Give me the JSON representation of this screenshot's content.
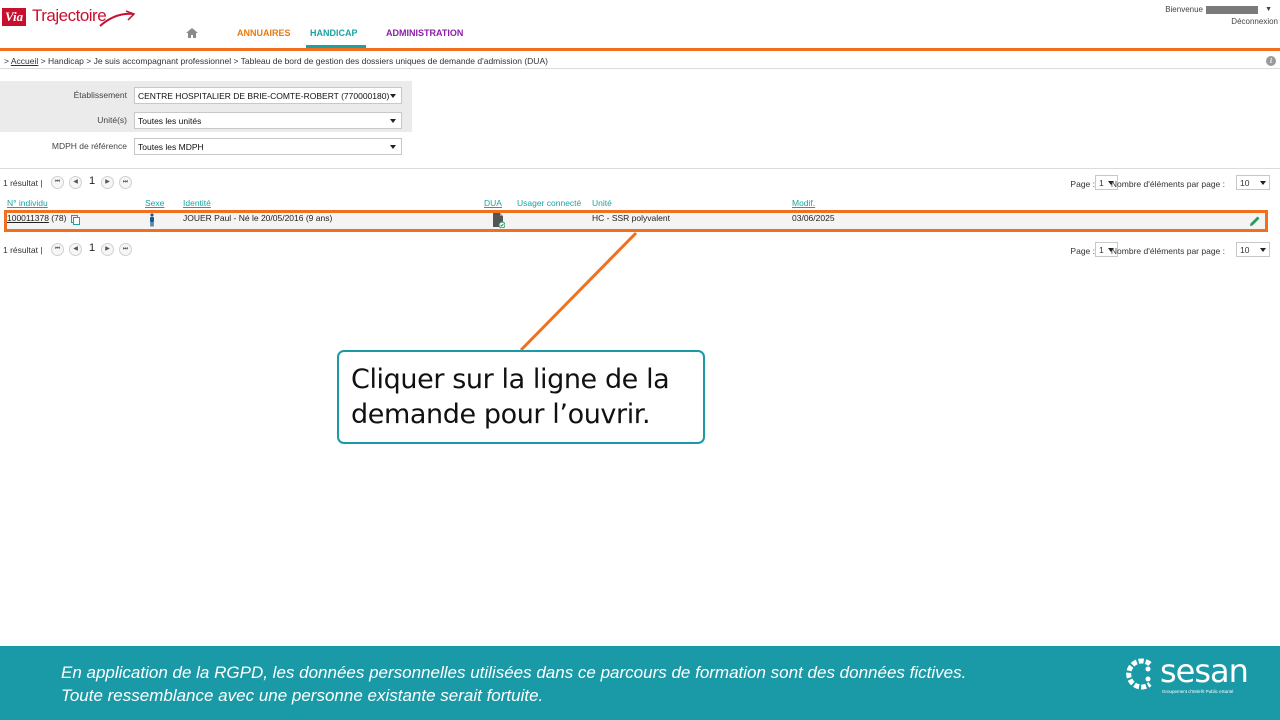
{
  "app": {
    "logo_via": "Via",
    "logo_traj": "Trajectoire"
  },
  "nav": {
    "annuaires": "ANNUAIRES",
    "handicap": "HANDICAP",
    "administration": "ADMINISTRATION"
  },
  "user": {
    "welcome": "Bienvenue",
    "logout": "Déconnexion"
  },
  "breadcrumb": {
    "prefix": ">",
    "home": "Accueil",
    "rest": "> Handicap > Je suis accompagnant professionnel > Tableau de bord de gestion des dossiers uniques de demande d'admission (DUA)"
  },
  "filters": [
    {
      "label": "Établissement",
      "value": "CENTRE HOSPITALIER DE BRIE-COMTE-ROBERT (770000180)"
    },
    {
      "label": "Unité(s)",
      "value": "Toutes les unités"
    },
    {
      "label": "MDPH de référence",
      "value": "Toutes les MDPH"
    }
  ],
  "pagination": {
    "results": "1 résultat |",
    "current_page": "1",
    "page_label": "Page :",
    "page_value": "1",
    "per_page_label": "Nombre d'éléments par page :",
    "per_page_value": "10"
  },
  "table": {
    "headers": {
      "individu": "N° individu",
      "sexe": "Sexe",
      "identite": "Identité",
      "dua": "DUA",
      "usager": "Usager connecté",
      "unite": "Unité",
      "modif": "Modif."
    },
    "rows": [
      {
        "individu": "100011378",
        "count": "(78)",
        "identite": "JOUER Paul - Né le 20/05/2016 (9 ans)",
        "unite": "HC - SSR polyvalent",
        "modif": "03/06/2025"
      }
    ]
  },
  "callout": {
    "text": "Cliquer sur la ligne de la demande pour l’ouvrir."
  },
  "footer": {
    "line1": "En application de la RGPD, les données personnelles utilisées dans ce parcours de formation sont des données fictives.",
    "line2": "Toute ressemblance avec une personne existante serait fortuite.",
    "brand": "sesan",
    "brand_sub": "Groupement d'Intérêt Public eSanté"
  },
  "colors": {
    "accent_orange": "#f07020",
    "accent_teal": "#1aa3a3",
    "footer_teal": "#1a9aa6",
    "admin_purple": "#8a1ea8",
    "brand_red": "#c8102e"
  }
}
